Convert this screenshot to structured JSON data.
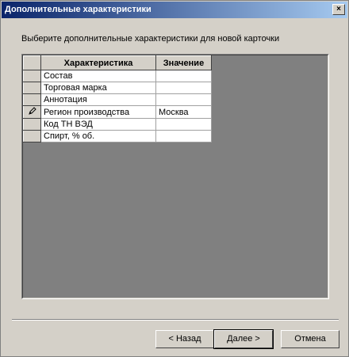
{
  "window": {
    "title": "Дополнительные характеристики",
    "close_label": "×"
  },
  "prompt": "Выберите дополнительные характеристики для новой карточки",
  "grid": {
    "columns": [
      "Характеристика",
      "Значение"
    ],
    "rows": [
      {
        "name": "Состав",
        "value": "",
        "editing": false
      },
      {
        "name": "Торговая марка",
        "value": "",
        "editing": false
      },
      {
        "name": "Аннотация",
        "value": "",
        "editing": false
      },
      {
        "name": "Регион производства",
        "value": "Москва",
        "editing": true
      },
      {
        "name": "Код ТН ВЭД",
        "value": "",
        "editing": false
      },
      {
        "name": "Спирт, % об.",
        "value": "",
        "editing": false
      }
    ],
    "edit_icon": "pencil-icon"
  },
  "buttons": {
    "back": "< Назад",
    "next": "Далее >",
    "cancel": "Отмена"
  }
}
